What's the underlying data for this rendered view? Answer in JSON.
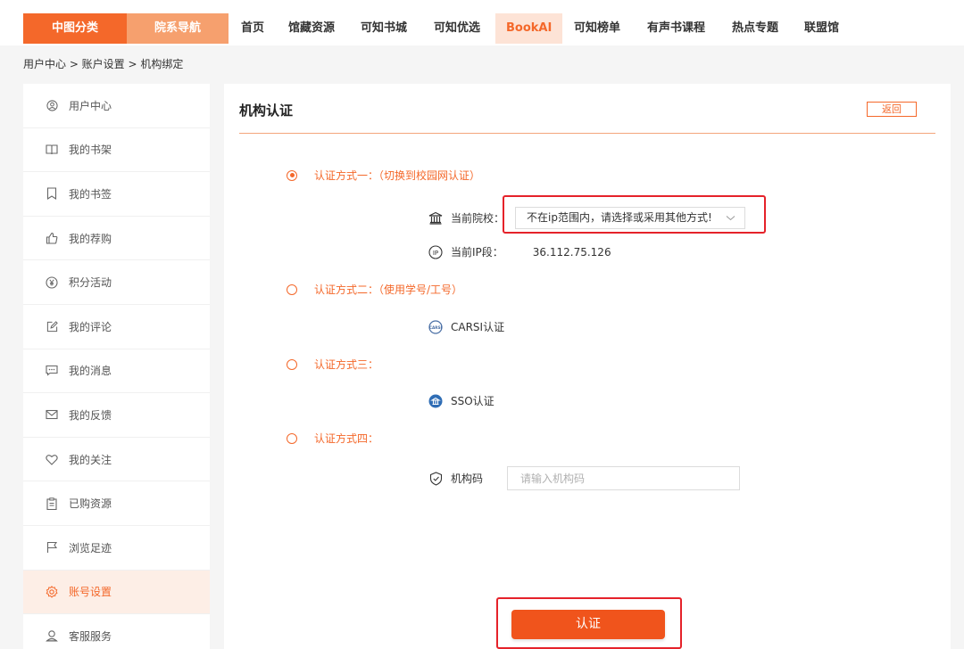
{
  "topnav": {
    "category_buttons": [
      "中图分类",
      "院系导航"
    ],
    "items": [
      "首页",
      "馆藏资源",
      "可知书城",
      "可知优选",
      "BookAI",
      "可知榜单",
      "有声书课程",
      "热点专题",
      "联盟馆"
    ],
    "active_item": "BookAI"
  },
  "breadcrumb": "用户中心 > 账户设置 > 机构绑定",
  "sidebar": {
    "items": [
      {
        "label": "用户中心",
        "icon": "user-circle-icon"
      },
      {
        "label": "我的书架",
        "icon": "book-open-icon"
      },
      {
        "label": "我的书签",
        "icon": "bookmark-icon"
      },
      {
        "label": "我的荐购",
        "icon": "thumbs-up-icon"
      },
      {
        "label": "积分活动",
        "icon": "yen-coin-icon"
      },
      {
        "label": "我的评论",
        "icon": "edit-icon"
      },
      {
        "label": "我的消息",
        "icon": "message-icon"
      },
      {
        "label": "我的反馈",
        "icon": "mail-icon"
      },
      {
        "label": "我的关注",
        "icon": "heart-icon"
      },
      {
        "label": "已购资源",
        "icon": "clipboard-icon"
      },
      {
        "label": "浏览足迹",
        "icon": "flag-icon"
      },
      {
        "label": "账号设置",
        "icon": "gear-icon"
      },
      {
        "label": "客服服务",
        "icon": "customer-service-icon"
      }
    ],
    "active_item": "账号设置"
  },
  "panel": {
    "title": "机构认证",
    "back_label": "返回",
    "method1": {
      "label": "认证方式一：（切换到校园网认证）",
      "checked": true
    },
    "school_label": "当前院校：",
    "school_value": "不在ip范围内，请选择或采用其他方式!",
    "ip_label": "当前IP段：",
    "ip_value": "36.112.75.126",
    "method2": {
      "label": "认证方式二：（使用学号/工号）",
      "checked": false
    },
    "carsi_label": "CARSI认证",
    "method3": {
      "label": "认证方式三：",
      "checked": false
    },
    "sso_label": "SSO认证",
    "method4": {
      "label": "认证方式四：",
      "checked": false
    },
    "code_label": "机构码",
    "code_placeholder": "请输入机构码",
    "code_value": "",
    "submit_label": "认证"
  },
  "colors": {
    "accent": "#f4682a",
    "accent_light": "#f6a06e",
    "highlight_box": "#e5222a",
    "button": "#f0541c"
  }
}
